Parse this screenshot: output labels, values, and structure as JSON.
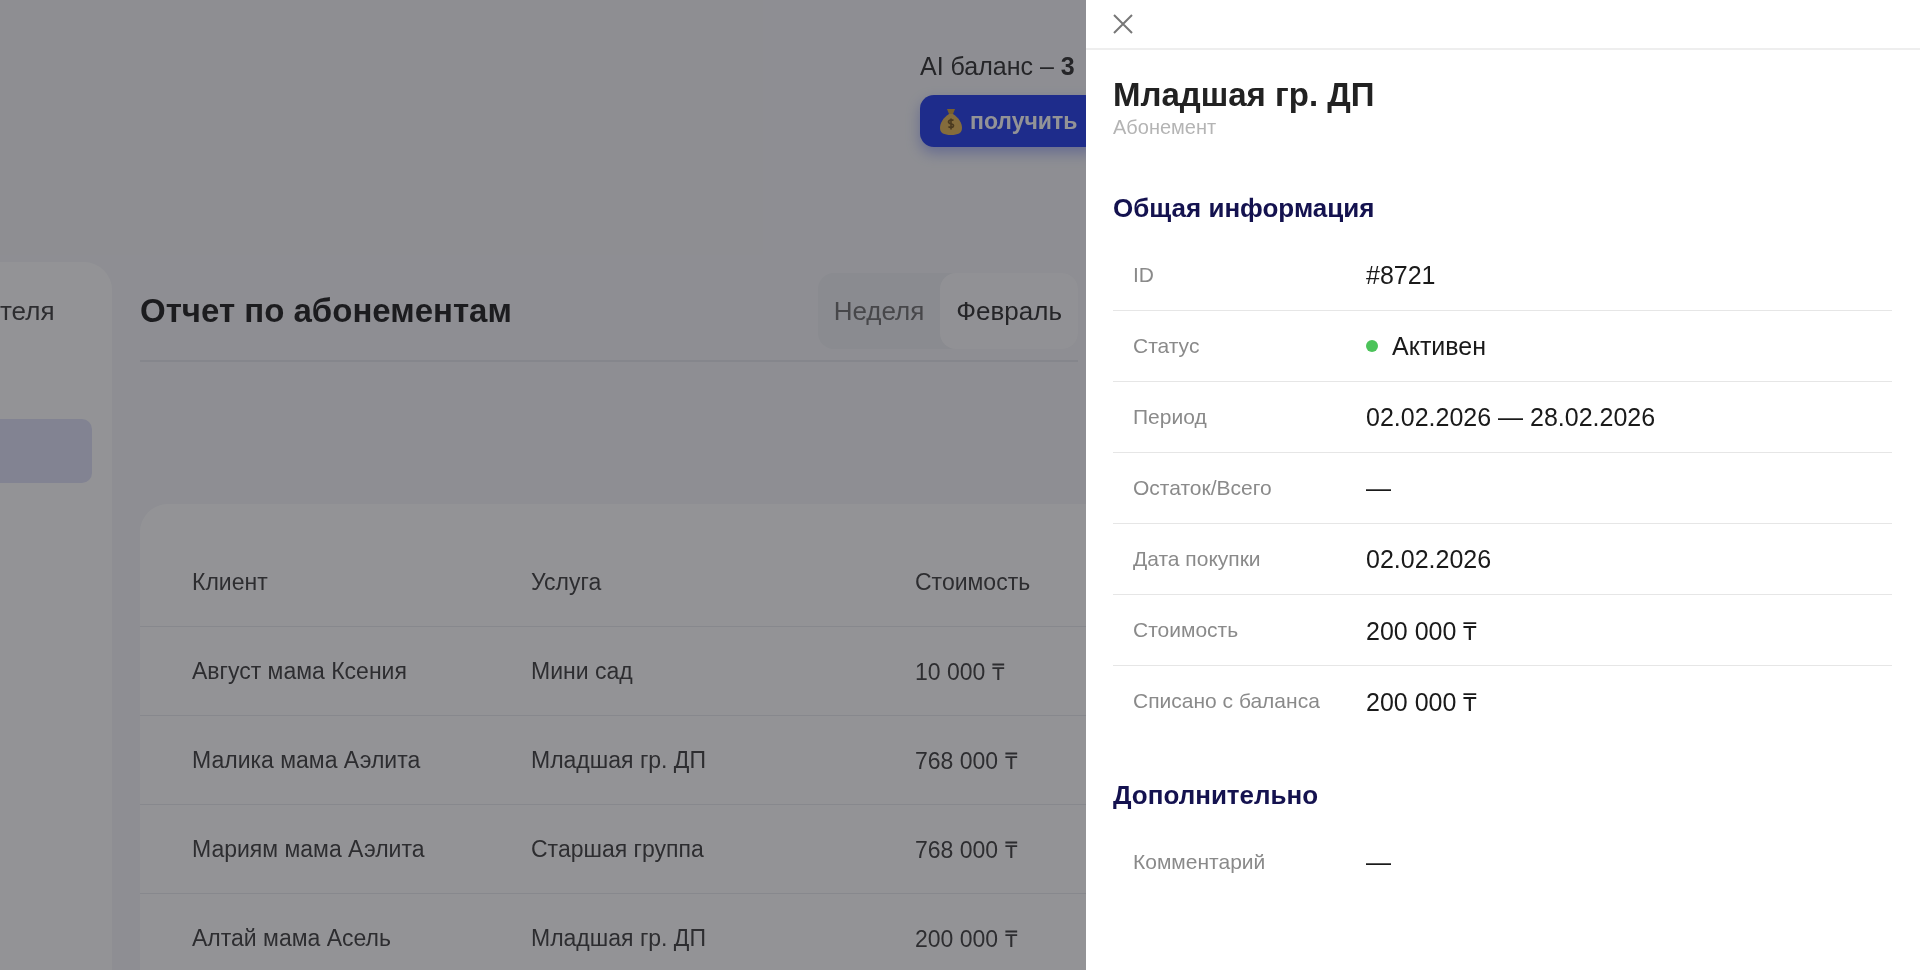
{
  "header": {
    "ai_balance": "AI баланс – **3**",
    "get_button": "получить"
  },
  "sidebar": {
    "item_text": "теля"
  },
  "report": {
    "title": "Отчет по абонементам",
    "tabs": [
      {
        "label": "Неделя",
        "selected": false
      },
      {
        "label": "Февраль",
        "selected": true
      }
    ]
  },
  "table": {
    "columns": [
      "Клиент",
      "Услуга",
      "Стоимость"
    ],
    "rows": [
      [
        "Август мама Ксения",
        "Мини сад",
        "10 000 ₸"
      ],
      [
        "Малика мама Аэлита",
        "Младшая гр. ДП",
        "768 000 ₸"
      ],
      [
        "Мариям мама Аэлита",
        "Старшая группа",
        "768 000 ₸"
      ],
      [
        "Алтай мама Асель",
        "Младшая гр. ДП",
        "200 000 ₸"
      ]
    ]
  },
  "drawer": {
    "title": "Младшая гр. ДП",
    "subtitle": "Абонемент",
    "sections": [
      {
        "heading": "Общая информация",
        "fields": [
          {
            "kind": "text",
            "label": "ID",
            "value": "#8721"
          },
          {
            "kind": "status",
            "label": "Статус",
            "value": "Активен",
            "color": "#4cc35a"
          },
          {
            "kind": "text",
            "label": "Период",
            "value": "02.02.2026 — 28.02.2026"
          },
          {
            "kind": "text",
            "label": "Остаток/Всего",
            "value": "—"
          },
          {
            "kind": "text",
            "label": "Дата покупки",
            "value": "02.02.2026"
          },
          {
            "kind": "text",
            "label": "Стоимость",
            "value": "200 000 ₸"
          },
          {
            "kind": "text",
            "label": "Списано с баланса",
            "value": "200 000 ₸"
          }
        ]
      },
      {
        "heading": "Дополнительно",
        "fields": [
          {
            "kind": "plain",
            "label": "Комментарий",
            "value": "—"
          }
        ]
      }
    ]
  }
}
